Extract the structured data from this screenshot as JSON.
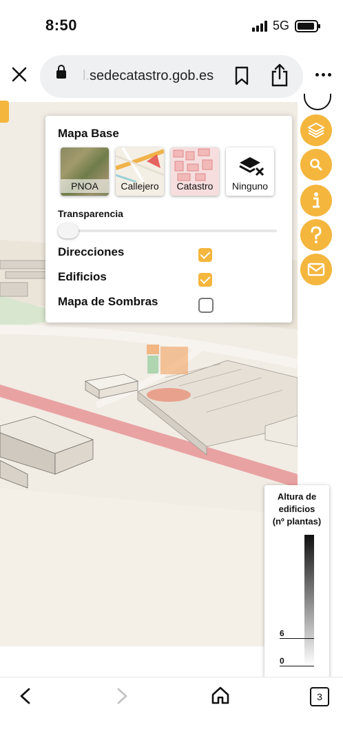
{
  "status_bar": {
    "time": "8:50",
    "network": "5G"
  },
  "browser": {
    "url_faded": "l.",
    "url": "sedecatastro.gob.es",
    "tab_count": "3",
    "icons": [
      "close-icon",
      "lock-icon",
      "bookmark-icon",
      "share-icon",
      "more-icon",
      "back-icon",
      "forward-icon",
      "home-icon",
      "tabs-icon"
    ]
  },
  "panel": {
    "title": "Mapa Base",
    "tiles": [
      {
        "label": "PNOA"
      },
      {
        "label": "Callejero"
      },
      {
        "label": "Catastro"
      },
      {
        "label": "Ninguno"
      }
    ],
    "transparency_label": "Transparencia",
    "transparency_value": 0,
    "layers": [
      {
        "label": "Direcciones",
        "checked": true
      },
      {
        "label": "Edificios",
        "checked": true
      },
      {
        "label": "Mapa de Sombras",
        "checked": false
      }
    ]
  },
  "tools": [
    "layers-icon",
    "search-icon",
    "info-icon",
    "help-icon",
    "mail-icon"
  ],
  "legend": {
    "title_line1": "Altura de",
    "title_line2": "edificios",
    "title_line3": "(nº plantas)",
    "tick_6": "6",
    "tick_0": "0"
  },
  "colors": {
    "accent": "#f4b63d",
    "road": "#e7a3a3"
  }
}
